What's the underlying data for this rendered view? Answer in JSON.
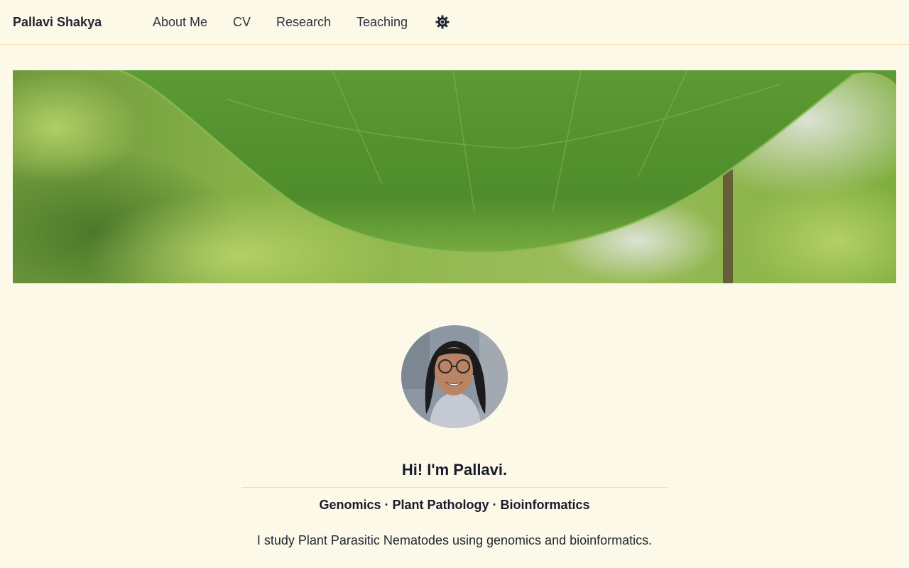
{
  "header": {
    "brand": "Pallavi Shakya",
    "nav": [
      {
        "label": "About Me"
      },
      {
        "label": "CV"
      },
      {
        "label": "Research"
      },
      {
        "label": "Teaching"
      }
    ],
    "theme_toggle_icon": "sun-gear-icon"
  },
  "hero": {
    "image": "green-leaf-banner"
  },
  "profile": {
    "avatar": "profile-photo",
    "greeting": "Hi! I'm Pallavi.",
    "tagline": "Genomics · Plant Pathology · Bioinformatics",
    "intro": "I study Plant Parasitic Nematodes using genomics and bioinformatics."
  },
  "colors": {
    "background": "#fdf9e9",
    "divider": "#f1dfa6",
    "text": "#1f2531"
  }
}
